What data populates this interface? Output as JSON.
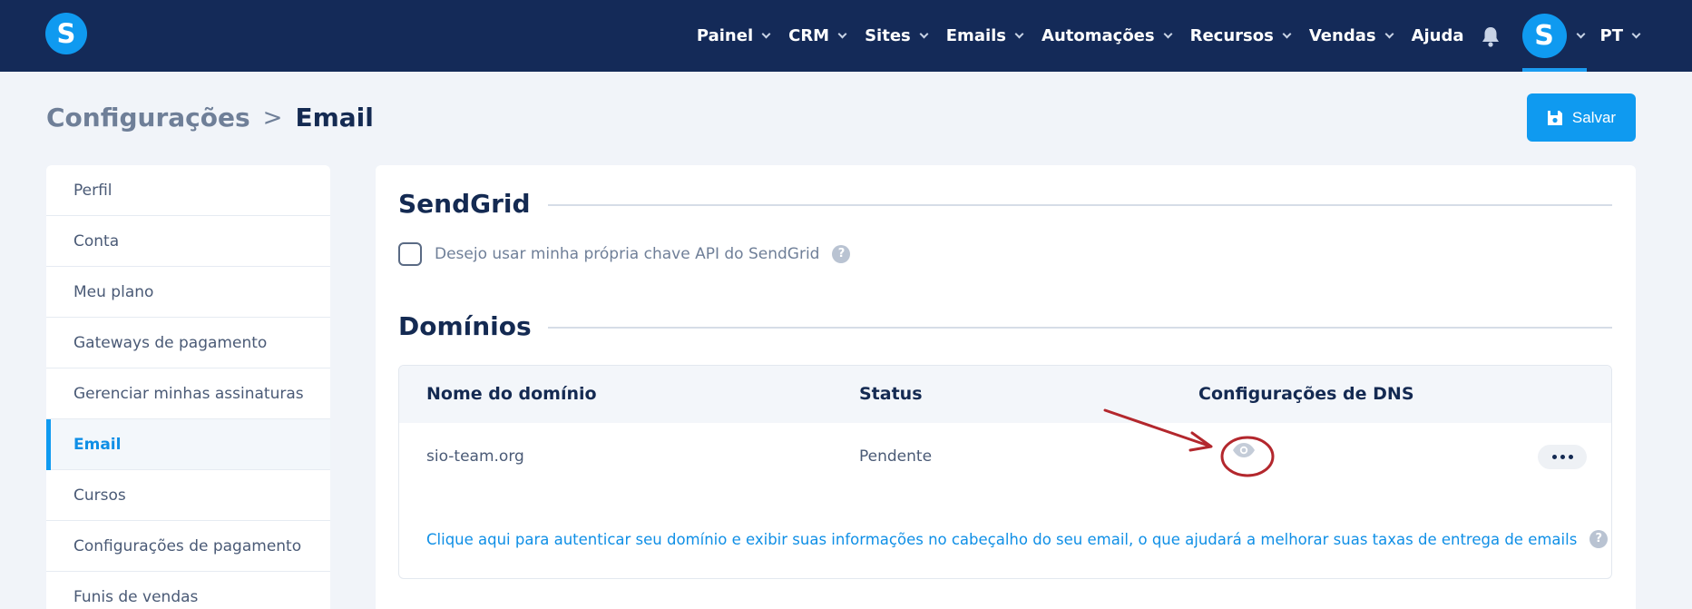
{
  "app": {
    "logo_letter": "S"
  },
  "nav": {
    "items": [
      {
        "label": "Painel",
        "has_dropdown": true
      },
      {
        "label": "CRM",
        "has_dropdown": true
      },
      {
        "label": "Sites",
        "has_dropdown": true
      },
      {
        "label": "Emails",
        "has_dropdown": true
      },
      {
        "label": "Automações",
        "has_dropdown": true
      },
      {
        "label": "Recursos",
        "has_dropdown": true
      },
      {
        "label": "Vendas",
        "has_dropdown": true
      },
      {
        "label": "Ajuda",
        "has_dropdown": false
      }
    ],
    "bell_icon": "bell-icon",
    "avatar_letter": "S",
    "language": "PT"
  },
  "breadcrumb": {
    "parent": "Configurações",
    "separator": ">",
    "current": "Email"
  },
  "actions": {
    "save_label": "Salvar",
    "save_icon": "floppy-disk-icon"
  },
  "sidebar": {
    "items": [
      {
        "label": "Perfil",
        "active": false
      },
      {
        "label": "Conta",
        "active": false
      },
      {
        "label": "Meu plano",
        "active": false
      },
      {
        "label": "Gateways de pagamento",
        "active": false
      },
      {
        "label": "Gerenciar minhas assinaturas",
        "active": false
      },
      {
        "label": "Email",
        "active": true
      },
      {
        "label": "Cursos",
        "active": false
      },
      {
        "label": "Configurações de pagamento",
        "active": false
      },
      {
        "label": "Funis de vendas",
        "active": false
      }
    ]
  },
  "sendgrid": {
    "title": "SendGrid",
    "checkbox_label": "Desejo usar minha própria chave API do SendGrid",
    "checked": false,
    "help": "?"
  },
  "domains": {
    "title": "Domínios",
    "columns": [
      "Nome do domínio",
      "Status",
      "Configurações de DNS"
    ],
    "rows": [
      {
        "domain": "sio-team.org",
        "status": "Pendente",
        "dns_icon": "eye-icon"
      }
    ],
    "auth_link": "Clique aqui para autenticar seu domínio e exibir suas informações no cabeçalho do seu email, o que ajudará a melhorar suas taxas de entrega de emails",
    "help": "?"
  },
  "colors": {
    "topbar": "#142a58",
    "accent": "#0f9af0",
    "annotation": "#b3272d"
  }
}
